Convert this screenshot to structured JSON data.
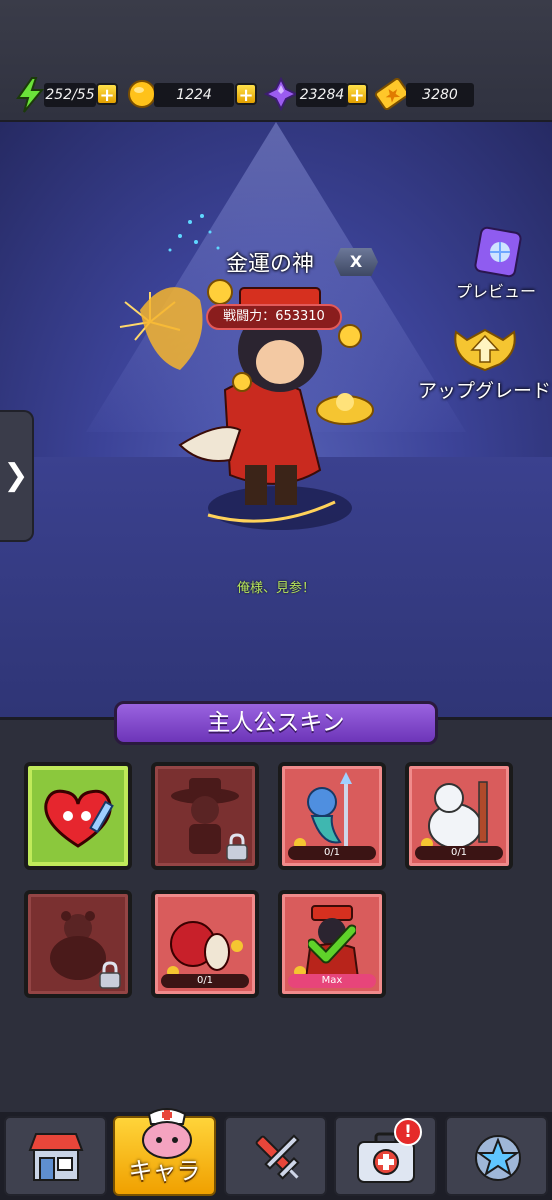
{
  "resources": {
    "energy": "252/55",
    "coins": "1224",
    "gems": "23284",
    "tickets": "3280",
    "plus_symbol": "+"
  },
  "hero": {
    "name": "金運の神",
    "tag": "X",
    "power_label": "戦闘力：",
    "power_value": "653310",
    "quote": "俺様、見参！"
  },
  "side_buttons": {
    "preview": "プレビュー",
    "upgrade": "アップグレード"
  },
  "side_tab_icon": "❯",
  "skins_section": {
    "title": "主人公スキン",
    "cards": [
      {
        "name": "heart-skin",
        "state": "selected",
        "progress": ""
      },
      {
        "name": "cowboy-skin",
        "state": "locked",
        "progress": ""
      },
      {
        "name": "mermaid-skin",
        "state": "available",
        "progress": "0/1"
      },
      {
        "name": "snow-bear-skin",
        "state": "available",
        "progress": "0/1"
      },
      {
        "name": "bear-skin",
        "state": "locked",
        "progress": ""
      },
      {
        "name": "apple-skin",
        "state": "available",
        "progress": "0/1"
      },
      {
        "name": "fortune-god-skin",
        "state": "equipped",
        "progress": "Max"
      }
    ]
  },
  "nav": {
    "items": [
      {
        "name": "shop",
        "label": ""
      },
      {
        "name": "character",
        "label": "キャラ"
      },
      {
        "name": "equipment",
        "label": ""
      },
      {
        "name": "medical",
        "label": "",
        "badge": "!"
      },
      {
        "name": "rank",
        "label": ""
      }
    ]
  },
  "colors": {
    "stage": "#3c4398",
    "card_red": "#d95c5c",
    "card_locked": "#7a3030",
    "card_selected": "#8bc83d",
    "banner": "#8a4fd0",
    "nav_active": "#f5b800"
  }
}
